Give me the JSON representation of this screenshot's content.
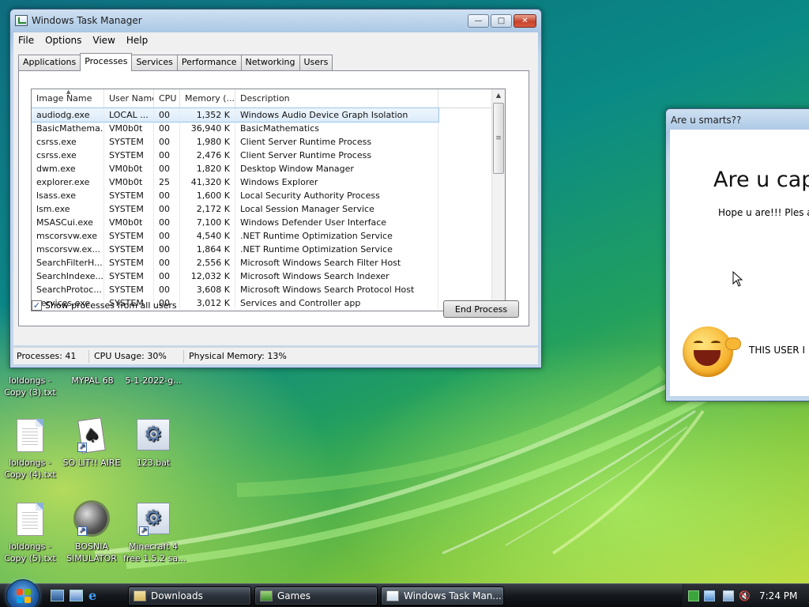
{
  "task_manager": {
    "title": "Windows Task Manager",
    "menu": [
      "File",
      "Options",
      "View",
      "Help"
    ],
    "tabs": [
      "Applications",
      "Processes",
      "Services",
      "Performance",
      "Networking",
      "Users"
    ],
    "active_tab": "Processes",
    "columns": [
      "Image Name",
      "User Name",
      "CPU",
      "Memory (...",
      "Description"
    ],
    "processes": [
      {
        "name": "audiodg.exe",
        "user": "LOCAL ...",
        "cpu": "00",
        "memory": "1,352 K",
        "description": "Windows Audio Device Graph Isolation"
      },
      {
        "name": "BasicMathema...",
        "user": "VM0b0t",
        "cpu": "00",
        "memory": "36,940 K",
        "description": "BasicMathematics"
      },
      {
        "name": "csrss.exe",
        "user": "SYSTEM",
        "cpu": "00",
        "memory": "1,980 K",
        "description": "Client Server Runtime Process"
      },
      {
        "name": "csrss.exe",
        "user": "SYSTEM",
        "cpu": "00",
        "memory": "2,476 K",
        "description": "Client Server Runtime Process"
      },
      {
        "name": "dwm.exe",
        "user": "VM0b0t",
        "cpu": "00",
        "memory": "1,820 K",
        "description": "Desktop Window Manager"
      },
      {
        "name": "explorer.exe",
        "user": "VM0b0t",
        "cpu": "25",
        "memory": "41,320 K",
        "description": "Windows Explorer"
      },
      {
        "name": "lsass.exe",
        "user": "SYSTEM",
        "cpu": "00",
        "memory": "1,600 K",
        "description": "Local Security Authority Process"
      },
      {
        "name": "lsm.exe",
        "user": "SYSTEM",
        "cpu": "00",
        "memory": "2,172 K",
        "description": "Local Session Manager Service"
      },
      {
        "name": "MSASCui.exe",
        "user": "VM0b0t",
        "cpu": "00",
        "memory": "7,100 K",
        "description": "Windows Defender User Interface"
      },
      {
        "name": "mscorsvw.exe",
        "user": "SYSTEM",
        "cpu": "00",
        "memory": "4,540 K",
        "description": ".NET Runtime Optimization Service"
      },
      {
        "name": "mscorsvw.ex...",
        "user": "SYSTEM",
        "cpu": "00",
        "memory": "1,864 K",
        "description": ".NET Runtime Optimization Service"
      },
      {
        "name": "SearchFilterH...",
        "user": "SYSTEM",
        "cpu": "00",
        "memory": "2,556 K",
        "description": "Microsoft Windows Search Filter Host"
      },
      {
        "name": "SearchIndexe...",
        "user": "SYSTEM",
        "cpu": "00",
        "memory": "12,032 K",
        "description": "Microsoft Windows Search Indexer"
      },
      {
        "name": "SearchProtoc...",
        "user": "SYSTEM",
        "cpu": "00",
        "memory": "3,608 K",
        "description": "Microsoft Windows Search Protocol Host"
      },
      {
        "name": "services.exe",
        "user": "SYSTEM",
        "cpu": "00",
        "memory": "3,012 K",
        "description": "Services and Controller app"
      }
    ],
    "show_all_label": "Show processes from all users",
    "end_process_label": "End Process",
    "status": {
      "processes": "Processes: 41",
      "cpu": "CPU Usage: 30%",
      "memory": "Physical Memory: 13%"
    }
  },
  "quiz_window": {
    "title": "Are u smarts??",
    "heading": "Are u capa",
    "subtext": "Hope u are!!! Ples a",
    "user_text": "THIS USER I"
  },
  "desktop_icons": [
    {
      "label": "loldongs -\nCopy (3).txt"
    },
    {
      "label": "MYPAL 68"
    },
    {
      "label": "5-1-2022-g..."
    },
    {
      "label": "loldongs -\nCopy (4).txt"
    },
    {
      "label": "SO LIT!! AIRE"
    },
    {
      "label": "123.bat"
    },
    {
      "label": "loldongs -\nCopy (5).txt"
    },
    {
      "label": "BOSNIA\nSIMULATOR"
    },
    {
      "label": "Minecraft 4\nfree 1.5.2 sa..."
    }
  ],
  "taskbar": {
    "buttons": [
      "Downloads",
      "Games",
      "Windows Task Man..."
    ],
    "clock": "7:24 PM"
  }
}
